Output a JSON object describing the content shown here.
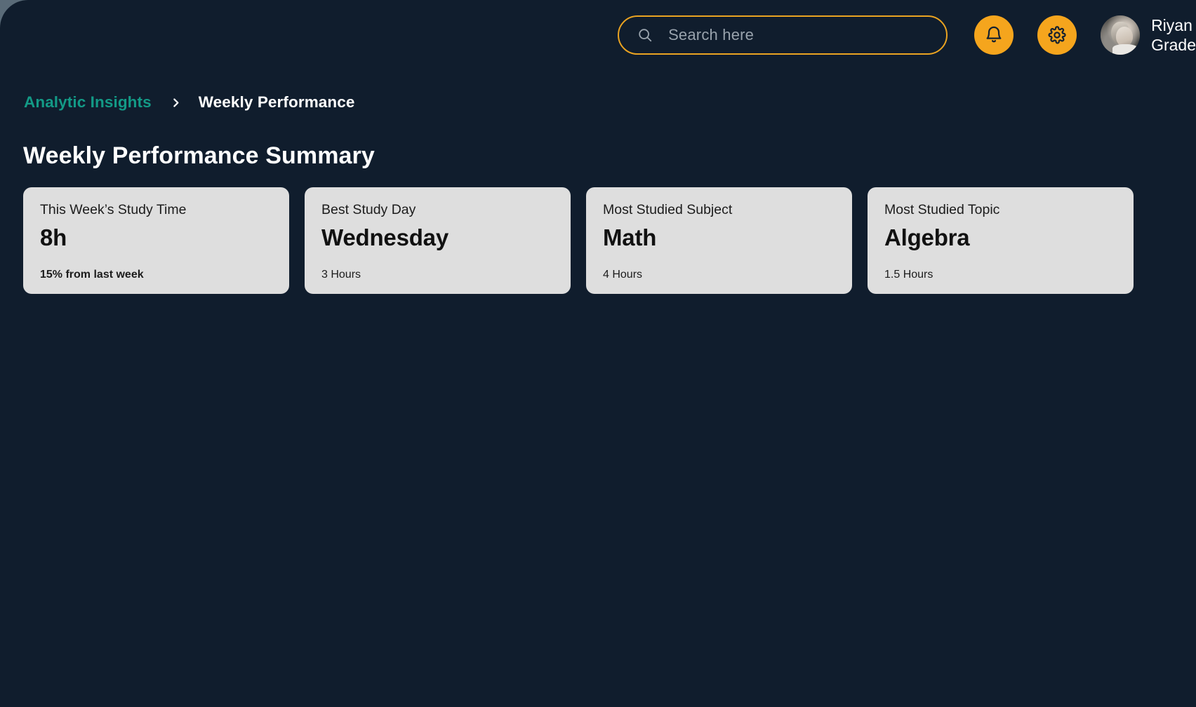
{
  "topbar": {
    "search": {
      "placeholder": "Search here",
      "value": "",
      "icon": "search-icon"
    },
    "notifications_icon": "bell-icon",
    "settings_icon": "gear-icon",
    "profile": {
      "name": "Riyan",
      "grade": "Grade",
      "avatar_alt": "avatar"
    }
  },
  "breadcrumb": {
    "parent": "Analytic Insights",
    "separator_icon": "chevron-right-icon",
    "current": "Weekly Performance"
  },
  "page": {
    "title": "Weekly Performance Summary"
  },
  "cards": [
    {
      "label": "This Week’s Study Time",
      "value": "8h",
      "footer": "15% from last week",
      "footer_bold": true
    },
    {
      "label": "Best Study Day",
      "value": "Wednesday",
      "footer": "3 Hours",
      "footer_bold": false
    },
    {
      "label": "Most Studied Subject",
      "value": "Math",
      "footer": "4 Hours",
      "footer_bold": false
    },
    {
      "label": "Most Studied Topic",
      "value": "Algebra",
      "footer": "1.5 Hours",
      "footer_bold": false
    }
  ],
  "colors": {
    "background": "#101d2d",
    "accent_orange": "#f5a51d",
    "accent_teal": "#139a86",
    "card_background": "#dedede",
    "text_light": "#ffffff"
  }
}
